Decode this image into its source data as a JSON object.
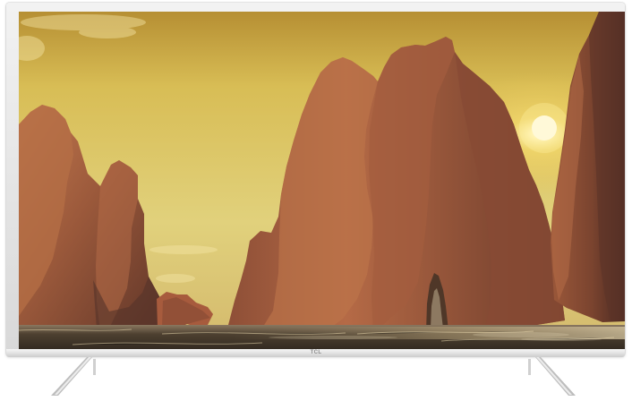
{
  "tv": {
    "brand_logo": "TCL"
  },
  "scene": {
    "sky_color": "#dcc45d",
    "rock_color": "#9a5437",
    "water_color": "#3a2f25",
    "sun_color": "#fff7df"
  },
  "colors": {
    "bezel": "#e6e6e6",
    "stand": "#d4d4d4"
  }
}
